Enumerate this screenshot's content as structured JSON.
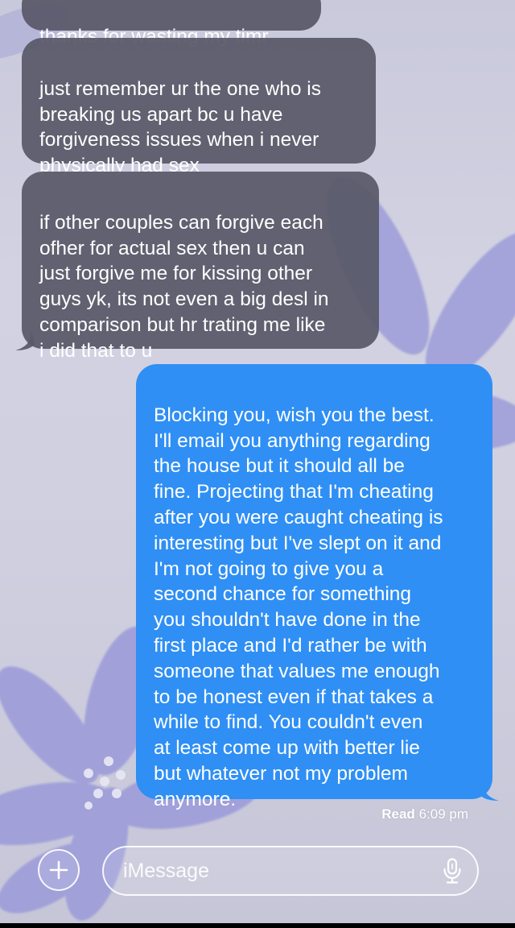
{
  "messages": [
    {
      "direction": "incoming",
      "text": "thanks for wasting my timr"
    },
    {
      "direction": "incoming",
      "text": "just remember ur the one who is\nbreaking us apart bc u have\nforgiveness issues when i never\nphysically had sex"
    },
    {
      "direction": "incoming",
      "text": "if other couples can forgive each\nofher for actual sex then u can\njust forgive me for kissing other\nguys yk, its not even a big desl in\ncomparison but hr trating me like\ni did that to u"
    },
    {
      "direction": "outgoing",
      "text": "Blocking you, wish you the best.\nI'll email you anything regarding\nthe house but it should all be\nfine. Projecting that I'm cheating\nafter you were caught cheating is\ninteresting but I've slept on it and\nI'm not going to give you a\nsecond chance for something\nyou shouldn't have done in the\nfirst place and I'd rather be with\nsomeone that values me enough\nto be honest even if that takes a\nwhile to find. You couldn't even\nat least come up with better lie\nbut whatever not my problem\nanymore."
    }
  ],
  "receipt": {
    "label": "Read",
    "time": "6:09 pm"
  },
  "composer": {
    "placeholder": "iMessage",
    "plus_icon": "plus-icon",
    "mic_icon": "microphone-icon"
  },
  "colors": {
    "outgoing_bubble": "#2f8ff4",
    "incoming_bubble": "#585868",
    "background": "#cfcfe0",
    "flower": "#9c9cd8"
  }
}
